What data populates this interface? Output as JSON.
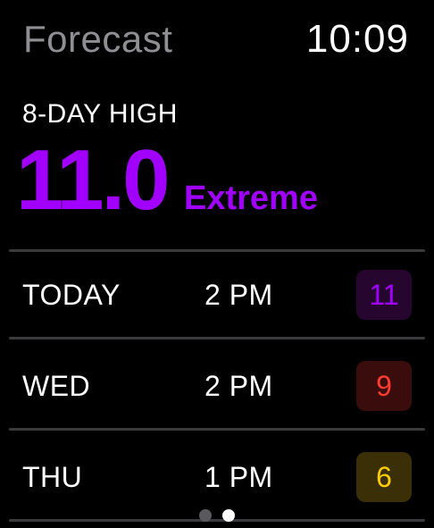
{
  "status": {
    "app_title": "Forecast",
    "time": "10:09"
  },
  "summary": {
    "label": "8-DAY HIGH",
    "value": "11.0",
    "level": "Extreme",
    "level_color": "#a100ff"
  },
  "forecast": [
    {
      "day": "TODAY",
      "time": "2 PM",
      "uv": "11",
      "color": "#a100ff",
      "bg": "#26062f"
    },
    {
      "day": "WED",
      "time": "2 PM",
      "uv": "9",
      "color": "#ff3b30",
      "bg": "#3a0d0c"
    },
    {
      "day": "THU",
      "time": "1 PM",
      "uv": "6",
      "color": "#ffcc00",
      "bg": "#3a2f06"
    }
  ],
  "pagination": {
    "pages": 2,
    "current": 2
  },
  "colors": {
    "background": "#000000",
    "title_gray": "#8e8e93",
    "divider": "#3a3a3c"
  }
}
